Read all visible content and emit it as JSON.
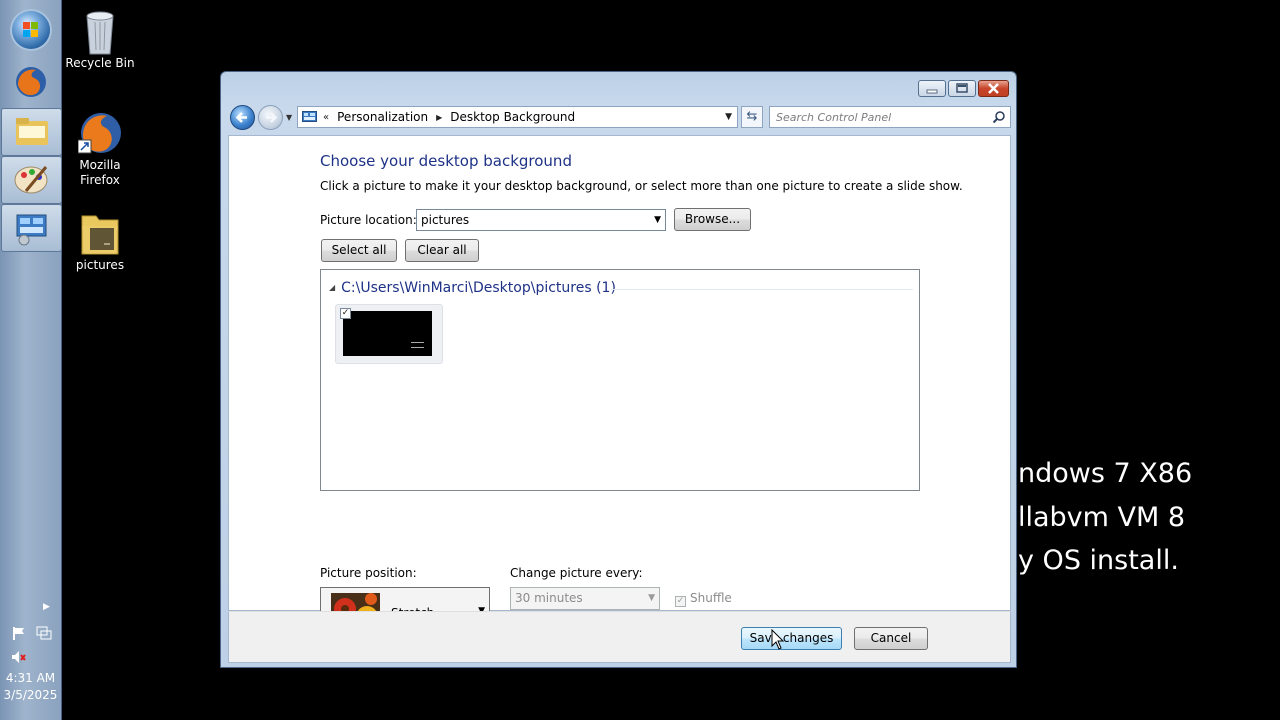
{
  "desktop": {
    "icons": [
      {
        "label": "Recycle Bin"
      },
      {
        "label": "Mozilla Firefox"
      },
      {
        "label": "pictures"
      }
    ],
    "background_text": [
      "ndows 7 X86",
      "llabvm VM 8",
      "y OS install."
    ]
  },
  "taskbar": {
    "clock_time": "4:31 AM",
    "clock_date": "3/5/2025",
    "pinned": [
      "start-orb",
      "firefox-icon",
      "explorer-icon",
      "paint-icon",
      "control-panel-icon"
    ]
  },
  "window": {
    "breadcrumb": [
      "Personalization",
      "Desktop Background"
    ],
    "search_placeholder": "Search Control Panel",
    "heading": "Choose your desktop background",
    "subtext": "Click a picture to make it your desktop background, or select more than one picture to create a slide show.",
    "picture_location_label": "Picture location:",
    "picture_location_value": "pictures",
    "browse_label": "Browse...",
    "select_all_label": "Select all",
    "clear_all_label": "Clear all",
    "group_header": "C:\\Users\\WinMarci\\Desktop\\pictures (1)",
    "picture_position_label": "Picture position:",
    "picture_position_value": "Stretch",
    "change_picture_label": "Change picture every:",
    "change_picture_value": "30 minutes",
    "shuffle_label": "Shuffle",
    "save_label": "Save changes",
    "cancel_label": "Cancel"
  }
}
